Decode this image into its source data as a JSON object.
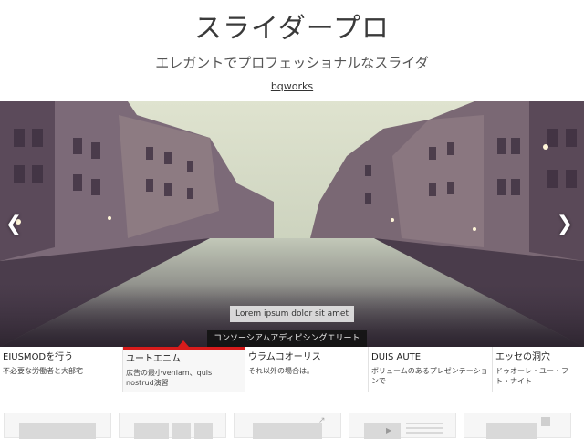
{
  "header": {
    "title": "スライダープロ",
    "subtitle": "エレガントでプロフェッショナルなスライダ",
    "link": "bqworks"
  },
  "slider": {
    "caption_top": "Lorem ipsum dolor sit amet",
    "caption_bottom": "コンソーシアムアディピシングエリート",
    "prev_icon": "chevron-left-icon",
    "next_icon": "chevron-right-icon"
  },
  "thumbnails": [
    {
      "title": "EIUSMODを行う",
      "desc": "不必要な労働者と大部宅"
    },
    {
      "title": "ユートエニム",
      "desc": "広告の最小veniam、quis nostrud演習"
    },
    {
      "title": "ウラムコオーリス",
      "desc": "それ以外の場合は。"
    },
    {
      "title": "DUIS AUTE",
      "desc": "ボリュームのあるプレゼンテーションで"
    },
    {
      "title": "エッセの洞穴",
      "desc": "ドゥオーレ・ユー・フト・ナイト"
    }
  ],
  "active_thumbnail_index": 1,
  "colors": {
    "accent": "#d81b1b",
    "background": "#ffffff"
  }
}
